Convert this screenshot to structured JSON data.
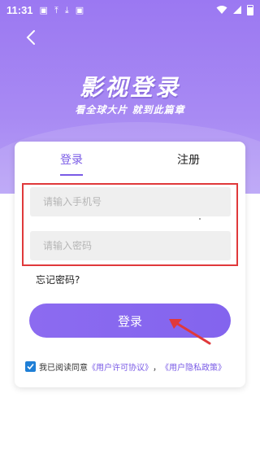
{
  "status_bar": {
    "time": "11:31",
    "icons": [
      "photo-icon",
      "upload-icon",
      "download-icon",
      "text-icon"
    ]
  },
  "header": {
    "title": "影视登录",
    "subtitle": "看全球大片   就到此篇章"
  },
  "tabs": [
    {
      "label": "登录",
      "active": true
    },
    {
      "label": "注册",
      "active": false
    }
  ],
  "form": {
    "phone_placeholder": "请输入手机号",
    "password_placeholder": "请输入密码",
    "forgot_label": "忘记密码?",
    "login_label": "登录"
  },
  "agreement": {
    "checked": true,
    "prefix": "我已阅读同意",
    "user_agreement": "《用户许可协议》",
    "separator": "，",
    "privacy_policy": "《用户隐私政策》"
  },
  "colors": {
    "accent": "#7a5be6",
    "highlight": "#e0393b",
    "annotation_arrow": "#e0393b",
    "checkbox": "#1f7fd6"
  }
}
